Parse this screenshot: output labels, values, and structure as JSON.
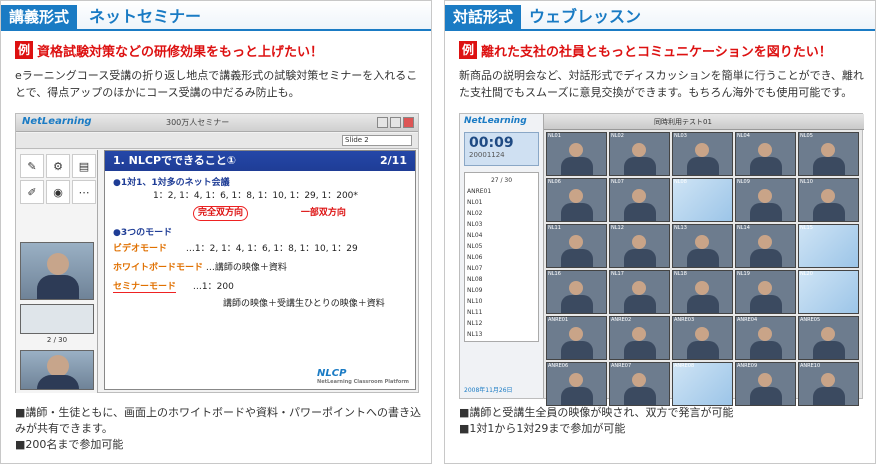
{
  "left": {
    "tag": "講義形式",
    "subtitle": "ネットセミナー",
    "example_badge": "例",
    "example_title": "資格試験対策などの研修効果をもっと上げたい！",
    "desc": "eラーニングコース受講の折り返し地点で講義形式の試験対策セミナーを入れることで、得点アップのほかにコース受講の中だるみ防止も。",
    "screenshot": {
      "logo": "NetLearning",
      "window_caption": "300万人セミナー",
      "slide_select": "Slide 2",
      "tools": [
        "ライト",
        "プロパティ",
        "報告",
        "メモ",
        "プレビュー",
        "その他"
      ],
      "count": "2 / 30",
      "slide_title": "1. NLCPでできること①",
      "slide_page": "2/11",
      "line1": "●1対1、1対多のネット会議",
      "line2": "1：2, 1：4, 1：6, 1：8, 1：10, 1：29, 1：200*",
      "line3a": "完全双方向",
      "line3b": "一部双方向",
      "line4": "●3つのモード",
      "mode1": "ビデオモード",
      "mode1_val": "…1：2, 1：4, 1：6, 1：8, 1：10, 1：29",
      "mode2": "ホワイトボードモード",
      "mode2_val": "…講師の映像＋資料",
      "mode3": "セミナーモード",
      "mode3_val": "…1：200",
      "mode3_sub": "講師の映像＋受講生ひとりの映像＋資料",
      "slide_logo": "NLCP",
      "slide_logo_sub": "NetLearning Classroom Platform"
    },
    "notes": [
      "■講師・生徒ともに、画面上のホワイトボードや資料・パワーポイントへの書き込",
      "みが共有できます。",
      "■200名まで参加可能"
    ]
  },
  "right": {
    "tag": "対話形式",
    "subtitle": "ウェブレッスン",
    "example_badge": "例",
    "example_title": "離れた支社の社員ともっとコミュニケーションを図りたい！",
    "desc": "新商品の説明会など、対話形式でディスカッションを簡単に行うことができ、離れた支社間でもスムーズに意見交換ができます。もちろん海外でも使用可能です。",
    "screenshot": {
      "logo": "NetLearning",
      "timer": "00:09",
      "timer_sub": "20001124",
      "window_caption": "同時利用テスト01",
      "list_header": "27 / 30",
      "list": [
        "ANRE01",
        "NL01",
        "NL02",
        "NL03",
        "NL04",
        "NL05",
        "NL06",
        "NL07",
        "NL08",
        "NL09",
        "NL10",
        "NL11",
        "NL12",
        "NL13"
      ],
      "date": "2008年11月26日",
      "cells": [
        "NL01",
        "NL02",
        "NL03",
        "NL04",
        "NL05",
        "NL06",
        "NL07",
        "NL08",
        "NL09",
        "NL10",
        "NL11",
        "NL12",
        "NL13",
        "NL14",
        "NL15",
        "NL16",
        "NL17",
        "NL18",
        "NL19",
        "NL20",
        "ANRE01",
        "ANRE02",
        "ANRE03",
        "ANRE04",
        "ANRE05",
        "ANRE06",
        "ANRE07",
        "ANRE08",
        "ANRE09",
        "ANRE10"
      ]
    },
    "notes": [
      "■講師と受講生全員の映像が映され、双方で発言が可能",
      "■1対1から1対29まで参加が可能"
    ]
  }
}
